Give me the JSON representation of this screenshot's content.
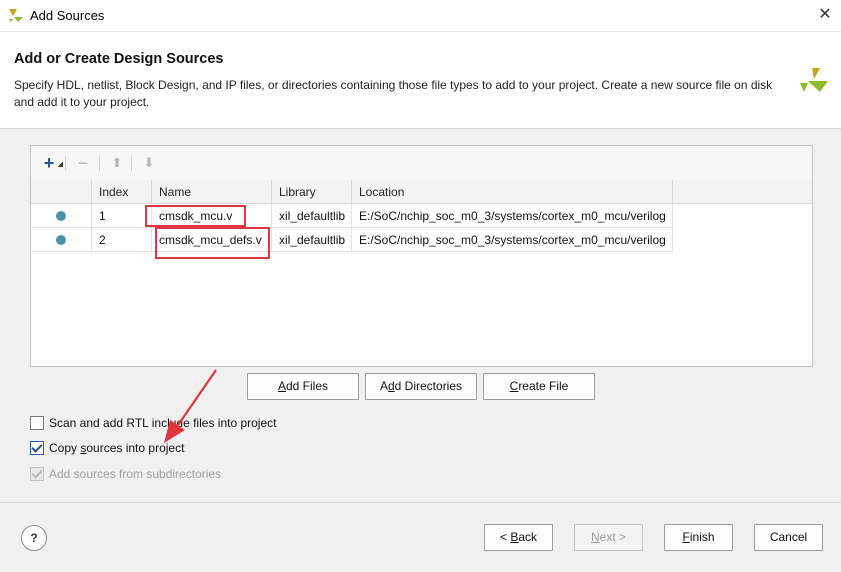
{
  "window": {
    "title": "Add Sources",
    "close_icon": "close-icon"
  },
  "header": {
    "title": "Add or Create Design Sources",
    "description": "Specify HDL, netlist, Block Design, and IP files, or directories containing those file types to add to your project. Create a new source file on disk and add it to your project."
  },
  "toolbar": {
    "add": "+",
    "remove": "−",
    "up": "⬆",
    "down": "⬇"
  },
  "table": {
    "columns": [
      "",
      "Index",
      "Name",
      "Library",
      "Location"
    ],
    "rows": [
      {
        "index": "1",
        "name": "cmsdk_mcu.v",
        "library": "xil_defaultlib",
        "location": "E:/SoC/nchip_soc_m0_3/systems/cortex_m0_mcu/verilog"
      },
      {
        "index": "2",
        "name": "cmsdk_mcu_defs.v",
        "library": "xil_defaultlib",
        "location": "E:/SoC/nchip_soc_m0_3/systems/cortex_m0_mcu/verilog"
      }
    ]
  },
  "actions": {
    "add_files": {
      "mnemonic": "A",
      "rest": "dd Files"
    },
    "add_directories": {
      "pre": "A",
      "mnemonic": "d",
      "rest": "d Directories"
    },
    "create_file": {
      "mnemonic": "C",
      "rest": "reate File"
    }
  },
  "options": {
    "scan_rtl": {
      "label": "Scan and add RTL include files into project",
      "checked": false
    },
    "copy_sources": {
      "pre": "Copy ",
      "mnemonic": "s",
      "rest": "ources into project",
      "checked": true
    },
    "add_subdirs": {
      "label": "Add sources from subdirectories",
      "checked": true,
      "enabled": false
    }
  },
  "footer": {
    "help": "?",
    "back": {
      "pre": "< ",
      "mnemonic": "B",
      "rest": "ack"
    },
    "next": {
      "mnemonic": "N",
      "rest": "ext >"
    },
    "finish": {
      "mnemonic": "F",
      "rest": "inish"
    },
    "cancel": "Cancel"
  },
  "colors": {
    "status_dot": "#4a93ad",
    "highlight": "#e0353f",
    "brand": "#8dbb2e"
  }
}
